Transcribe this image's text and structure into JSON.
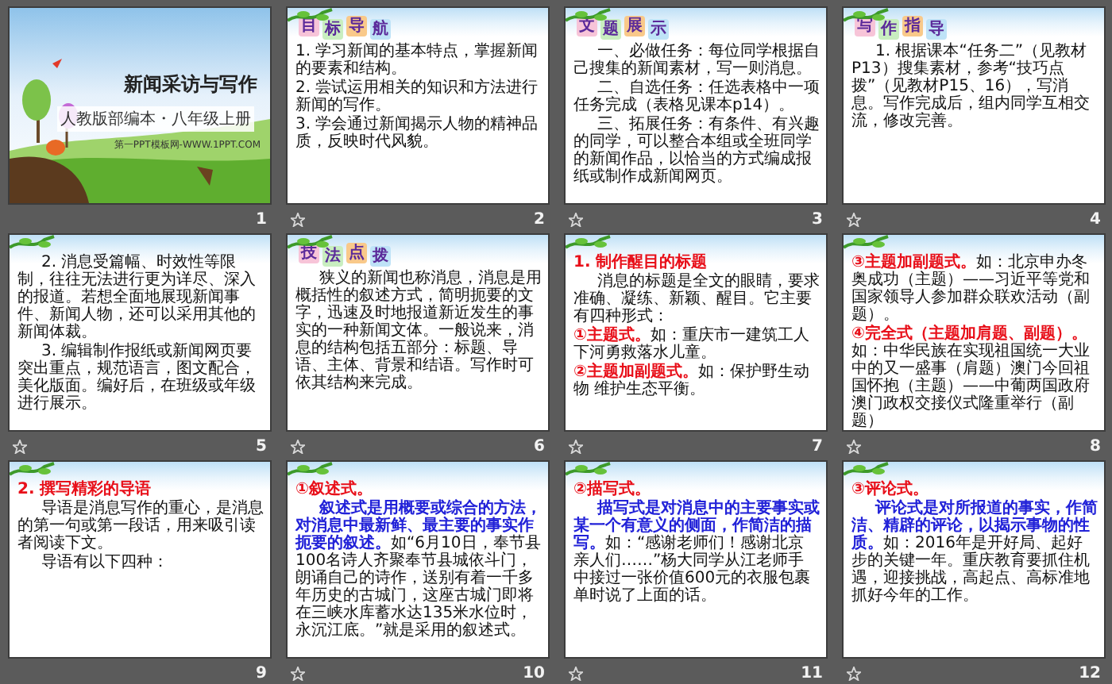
{
  "slides": [
    {
      "number": "1",
      "animated": false,
      "kind": "title",
      "title": "新闻采访与写作",
      "subtitle": "人教版部编本・八年级上册",
      "footer_text": "第一PPT模板网-WWW.1PPT.COM"
    },
    {
      "number": "2",
      "animated": true,
      "kind": "content",
      "badge": [
        "目",
        "标",
        "导",
        "航"
      ],
      "paragraphs": [
        {
          "kind": "item",
          "runs": [
            {
              "kind": "plain",
              "text": "1. 学习新闻的基本特点，掌握新闻的要素和结构。"
            }
          ]
        },
        {
          "kind": "item",
          "runs": [
            {
              "kind": "plain",
              "text": "2. 尝试运用相关的知识和方法进行新闻的写作。"
            }
          ]
        },
        {
          "kind": "item",
          "runs": [
            {
              "kind": "plain",
              "text": "3. 学会通过新闻揭示人物的精神品质，反映时代风貌。"
            }
          ]
        }
      ]
    },
    {
      "number": "3",
      "animated": true,
      "kind": "content",
      "badge": [
        "文",
        "题",
        "展",
        "示"
      ],
      "paragraphs": [
        {
          "kind": "body",
          "runs": [
            {
              "kind": "plain",
              "text": "一、必做任务：每位同学根据自己搜集的新闻素材，写一则消息。"
            }
          ]
        },
        {
          "kind": "body",
          "runs": [
            {
              "kind": "plain",
              "text": "二、自选任务：任选表格中一项任务完成（表格见课本p14）。"
            }
          ]
        },
        {
          "kind": "body",
          "runs": [
            {
              "kind": "plain",
              "text": "三、拓展任务：有条件、有兴趣的同学，可以整合本组或全班同学的新闻作品，以恰当的方式编成报纸或制作成新闻网页。"
            }
          ]
        }
      ]
    },
    {
      "number": "4",
      "animated": true,
      "kind": "content",
      "badge": [
        "写",
        "作",
        "指",
        "导"
      ],
      "paragraphs": [
        {
          "kind": "body",
          "runs": [
            {
              "kind": "plain",
              "text": "1. 根据课本“任务二”（见教材P13）搜集素材，参考“技巧点拨”（见教材P15、16），写消息。写作完成后，组内同学互相交流，修改完善。"
            }
          ]
        }
      ]
    },
    {
      "number": "5",
      "animated": true,
      "kind": "content",
      "paragraphs": [
        {
          "kind": "body",
          "runs": [
            {
              "kind": "plain",
              "text": "2. 消息受篇幅、时效性等限制，往往无法进行更为详尽、深入的报道。若想全面地展现新闻事件、新闻人物，还可以采用其他的新闻体裁。"
            }
          ]
        },
        {
          "kind": "body",
          "runs": [
            {
              "kind": "plain",
              "text": "3. 编辑制作报纸或新闻网页要突出重点，规范语言，图文配合，美化版面。编好后，在班级或年级进行展示。"
            }
          ]
        }
      ]
    },
    {
      "number": "6",
      "animated": true,
      "kind": "content",
      "badge": [
        "技",
        "法",
        "点",
        "拨"
      ],
      "paragraphs": [
        {
          "kind": "body",
          "runs": [
            {
              "kind": "plain",
              "text": "狭义的新闻也称消息，消息是用概括性的叙述方式，简明扼要的文字，迅速及时地报道新近发生的事实的一种新闻文体。一般说来，消息的结构包括五部分：标题、导语、主体、背景和结语。写作时可依其结构来完成。"
            }
          ]
        }
      ]
    },
    {
      "number": "7",
      "animated": true,
      "kind": "content",
      "paragraphs": [
        {
          "kind": "heading",
          "runs": [
            {
              "kind": "label",
              "text": "1. 制作醒目的标题"
            }
          ]
        },
        {
          "kind": "body",
          "runs": [
            {
              "kind": "plain",
              "text": "消息的标题是全文的眼睛，要求准确、凝练、新颖、醒目。它主要有四种形式："
            }
          ]
        },
        {
          "kind": "item",
          "runs": [
            {
              "kind": "label",
              "text": "①主题式。"
            },
            {
              "kind": "plain",
              "text": "如：重庆市一建筑工人下河勇救落水儿童。"
            }
          ]
        },
        {
          "kind": "item",
          "runs": [
            {
              "kind": "label",
              "text": "②主题加副题式。"
            },
            {
              "kind": "plain",
              "text": "如：保护野生动物 维护生态平衡。"
            }
          ]
        }
      ]
    },
    {
      "number": "8",
      "animated": true,
      "kind": "content",
      "paragraphs": [
        {
          "kind": "item",
          "runs": [
            {
              "kind": "label",
              "text": "③主题加副题式。"
            },
            {
              "kind": "plain",
              "text": "如：北京申办冬奥成功（主题）——习近平等党和国家领导人参加群众联欢活动（副题）。"
            }
          ]
        },
        {
          "kind": "item",
          "runs": [
            {
              "kind": "label",
              "text": "④完全式（主题加肩题、副题）。"
            },
            {
              "kind": "plain",
              "text": "如：中华民族在实现祖国统一大业中的又一盛事（肩题）澳门今回祖国怀抱（主题）——中葡两国政府澳门政权交接仪式隆重举行（副题）"
            }
          ]
        }
      ]
    },
    {
      "number": "9",
      "animated": false,
      "kind": "content",
      "paragraphs": [
        {
          "kind": "heading",
          "runs": [
            {
              "kind": "label",
              "text": "2. 撰写精彩的导语"
            }
          ]
        },
        {
          "kind": "body",
          "runs": [
            {
              "kind": "plain",
              "text": "导语是消息写作的重心，是消息的第一句或第一段话，用来吸引读者阅读下文。"
            }
          ]
        },
        {
          "kind": "body",
          "runs": [
            {
              "kind": "plain",
              "text": "导语有以下四种："
            }
          ]
        }
      ]
    },
    {
      "number": "10",
      "animated": true,
      "kind": "content",
      "paragraphs": [
        {
          "kind": "heading",
          "runs": [
            {
              "kind": "label",
              "text": "①叙述式。"
            }
          ]
        },
        {
          "kind": "body",
          "runs": [
            {
              "kind": "definition",
              "text": "叙述式是用概要或综合的方法，对消息中最新鲜、最主要的事实作扼要的叙述。"
            },
            {
              "kind": "plain",
              "text": "如“6月10日，奉节县100名诗人齐聚奉节县城依斗门，朗诵自己的诗作，送别有着一千多年历史的古城门，这座古城门即将在三峡水库蓄水达135米水位时，永沉江底。”就是采用的叙述式。"
            }
          ]
        }
      ]
    },
    {
      "number": "11",
      "animated": true,
      "kind": "content",
      "paragraphs": [
        {
          "kind": "heading",
          "runs": [
            {
              "kind": "label",
              "text": "②描写式。"
            }
          ]
        },
        {
          "kind": "body",
          "runs": [
            {
              "kind": "definition",
              "text": "描写式是对消息中的主要事实或某一个有意义的侧面，作简洁的描写。"
            },
            {
              "kind": "plain",
              "text": "如：“感谢老师们！感谢北京亲人们……”杨大同学从江老师手中接过一张价值600元的衣服包裹单时说了上面的话。"
            }
          ]
        }
      ]
    },
    {
      "number": "12",
      "animated": true,
      "kind": "content",
      "paragraphs": [
        {
          "kind": "heading",
          "runs": [
            {
              "kind": "label",
              "text": "③评论式。"
            }
          ]
        },
        {
          "kind": "body",
          "runs": [
            {
              "kind": "definition",
              "text": "评论式是对所报道的事实，作简洁、精辟的评论，以揭示事物的性质。"
            },
            {
              "kind": "plain",
              "text": "如：2016年是开好局、起好步的关键一年。重庆教育要抓住机遇，迎接挑战，高起点、高标准地抓好今年的工作。"
            }
          ]
        }
      ]
    }
  ]
}
